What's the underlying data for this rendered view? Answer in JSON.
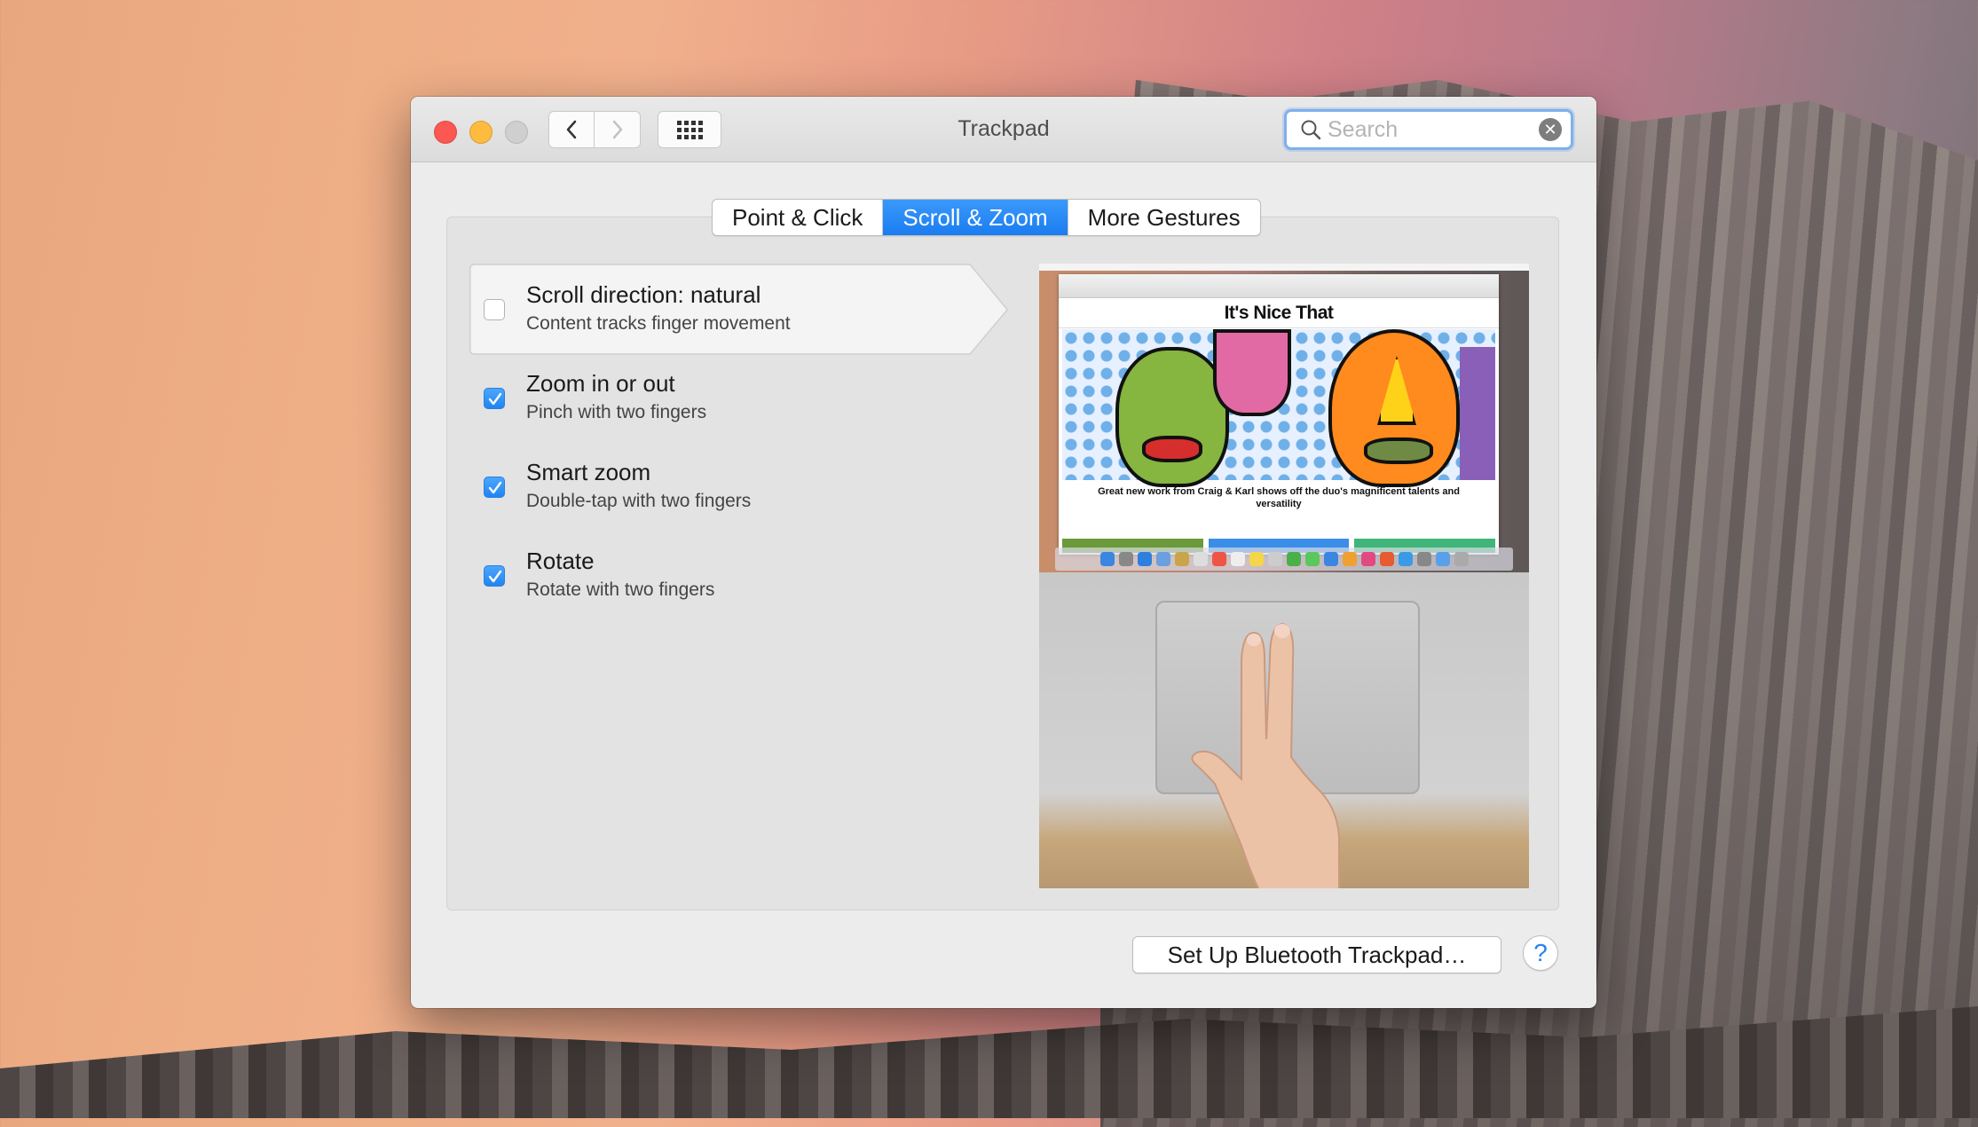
{
  "window": {
    "title": "Trackpad"
  },
  "search": {
    "placeholder": "Search",
    "value": ""
  },
  "tabs": [
    {
      "label": "Point & Click",
      "active": false
    },
    {
      "label": "Scroll & Zoom",
      "active": true
    },
    {
      "label": "More Gestures",
      "active": false
    }
  ],
  "options": [
    {
      "title": "Scroll direction: natural",
      "subtitle": "Content tracks finger movement",
      "checked": false,
      "selected": true
    },
    {
      "title": "Zoom in or out",
      "subtitle": "Pinch with two fingers",
      "checked": true,
      "selected": false
    },
    {
      "title": "Smart zoom",
      "subtitle": "Double-tap with two fingers",
      "checked": true,
      "selected": false
    },
    {
      "title": "Rotate",
      "subtitle": "Rotate with two fingers",
      "checked": true,
      "selected": false
    }
  ],
  "preview": {
    "site_title": "It's Nice That",
    "caption": "Great new work from Craig & Karl shows off the duo's magnificent talents and versatility"
  },
  "footer": {
    "setup_button": "Set Up Bluetooth Trackpad…",
    "help_button": "?"
  },
  "colors": {
    "accent": "#1a7cf0",
    "close": "#fc5753",
    "minimize": "#fdbc40",
    "zoom_disabled": "#cfcfcf"
  },
  "icons": {
    "back": "chevron-left-icon",
    "forward": "chevron-right-icon",
    "show_all": "grid-icon",
    "search": "search-icon",
    "clear": "clear-icon"
  }
}
